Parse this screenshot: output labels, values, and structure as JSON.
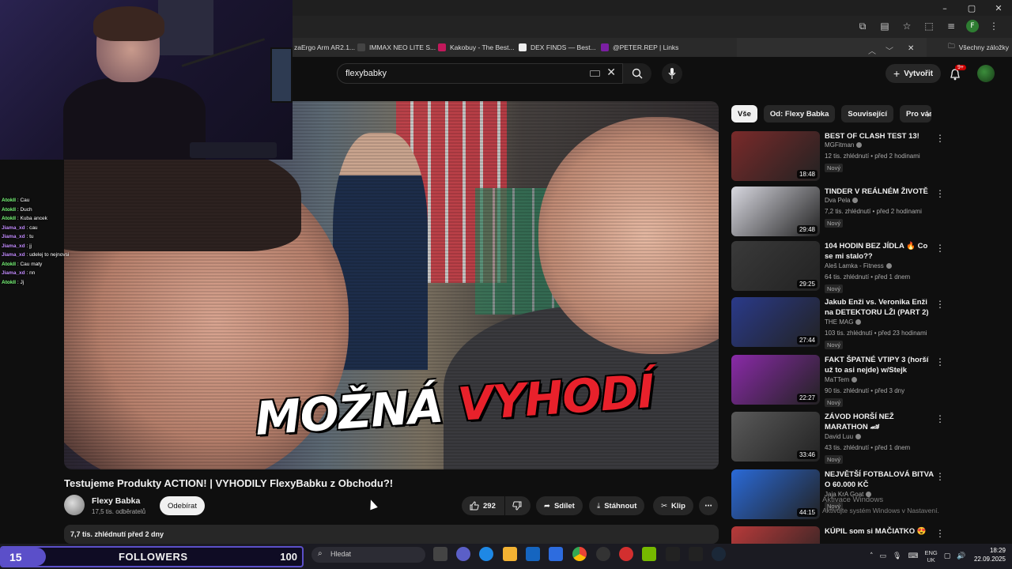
{
  "browser": {
    "bookmarks": [
      {
        "label": "zaErgo Arm AR2.1...",
        "color": "#555555"
      },
      {
        "label": "IMMAX NEO LITE S...",
        "color": "#3a3a3a"
      },
      {
        "label": "Kakobuy - The Best...",
        "color": "#c2185b"
      },
      {
        "label": "DEX FINDS — Best...",
        "color": "#eeeeee"
      },
      {
        "label": "@PETER.REP | Links",
        "color": "#7b1fa2"
      }
    ],
    "bookmarks_folder": "Všechny záložky",
    "profile_initial": "F"
  },
  "youtube": {
    "search_query": "flexybabky",
    "create_label": "Vytvořit",
    "notification_count": "9+"
  },
  "chat": [
    {
      "user": "Atokll",
      "msg": "Cau",
      "color": "#7cff7c"
    },
    {
      "user": "Atokll",
      "msg": "Duch",
      "color": "#7cff7c"
    },
    {
      "user": "Atokll",
      "msg": "Kuba ancek",
      "color": "#7cff7c"
    },
    {
      "user": "Jiama_xd",
      "msg": "cau",
      "color": "#c38cff"
    },
    {
      "user": "Jiama_xd",
      "msg": "tu",
      "color": "#c38cff"
    },
    {
      "user": "Jiama_xd",
      "msg": "jj",
      "color": "#c38cff"
    },
    {
      "user": "Jiama_xd",
      "msg": "udelej to nejnovsi",
      "color": "#c38cff"
    },
    {
      "user": "Atokll",
      "msg": "Cau maty",
      "color": "#7cff7c"
    },
    {
      "user": "Jiama_xd",
      "msg": "nn",
      "color": "#c38cff"
    },
    {
      "user": "Atokll",
      "msg": "Jj",
      "color": "#7cff7c"
    }
  ],
  "video": {
    "caption_white": "MOŽNÁ",
    "caption_red": "VYHODÍ",
    "title": "Testujeme Produkty ACTION! | VYHODILY FlexyBabku z Obchodu?!",
    "channel": "Flexy Babka",
    "subscribers": "17,5 tis. odběratelů",
    "subscribe_label": "Odebírat",
    "likes": "292",
    "share_label": "Sdílet",
    "download_label": "Stáhnout",
    "clip_label": "Klip",
    "views_date": "7,7 tis. zhlédnutí  před 2 dny"
  },
  "chips": [
    "Vše",
    "Od: Flexy Babka",
    "Související",
    "Pro vás"
  ],
  "related": [
    {
      "title": "BEST OF CLASH TEST 13!",
      "channel": "MGFitman",
      "meta": "12 tis. zhlédnutí • před 2 hodinami",
      "badge": "Nový",
      "duration": "18:48",
      "thumb": "#7a2a2a"
    },
    {
      "title": "TINDER V REÁLNÉM ŽIVOTĚ",
      "channel": "Dva Pela",
      "meta": "7,2 tis. zhlédnutí • před 2 hodinami",
      "badge": "Nový",
      "duration": "29:48",
      "thumb": "#d8d8e0"
    },
    {
      "title": "104 HODIN BEZ JÍDLA 🔥 Co se mi stalo??",
      "channel": "Aleš Lamka - Fitness",
      "meta": "64 tis. zhlédnutí • před 1 dnem",
      "badge": "Nový",
      "duration": "29:25",
      "thumb": "#3a3a3a"
    },
    {
      "title": "Jakub Enži vs. Veronika Enži na DETEKTORU LŽI (PART 2)",
      "channel": "THE MAG",
      "meta": "103 tis. zhlédnutí • před 23 hodinami",
      "badge": "Nový",
      "duration": "27:44",
      "thumb": "#2a3a8a"
    },
    {
      "title": "FAKT ŠPATNÉ VTIPY 3 (horší už to asi nejde) w/Stejk",
      "channel": "MaTTem",
      "meta": "90 tis. zhlédnutí • před 3 dny",
      "badge": "Nový",
      "duration": "22:27",
      "thumb": "#8a2aa8"
    },
    {
      "title": "ZÁVOD HORŠÍ NEŽ MARATHON 🏎",
      "channel": "David Luu",
      "meta": "43 tis. zhlédnutí • před 1 dnem",
      "badge": "Nový",
      "duration": "33:46",
      "thumb": "#5a5a5a"
    },
    {
      "title": "NEJVĚTŠÍ FOTBALOVÁ BITVA O 60.000 KČ",
      "channel": "Jaja KrA Goat",
      "meta": "",
      "badge": "Nový",
      "duration": "44:15",
      "thumb": "#2a6ad8"
    },
    {
      "title": "KÚPIL som si MAČIATKO 😍",
      "channel": "",
      "meta": "",
      "badge": "",
      "duration": "",
      "thumb": "#b83a3a"
    }
  ],
  "windows_activation": {
    "line1": "Aktivace Windows",
    "line2": "Aktivujte systém Windows v Nastavení."
  },
  "followers_bar": {
    "count": "15",
    "label": "FOLLOWERS",
    "goal": "100"
  },
  "taskbar": {
    "search_placeholder": "Hledat",
    "lang_1": "ENG",
    "lang_2": "UK",
    "time": "18:29",
    "date": "22.09.2025"
  }
}
